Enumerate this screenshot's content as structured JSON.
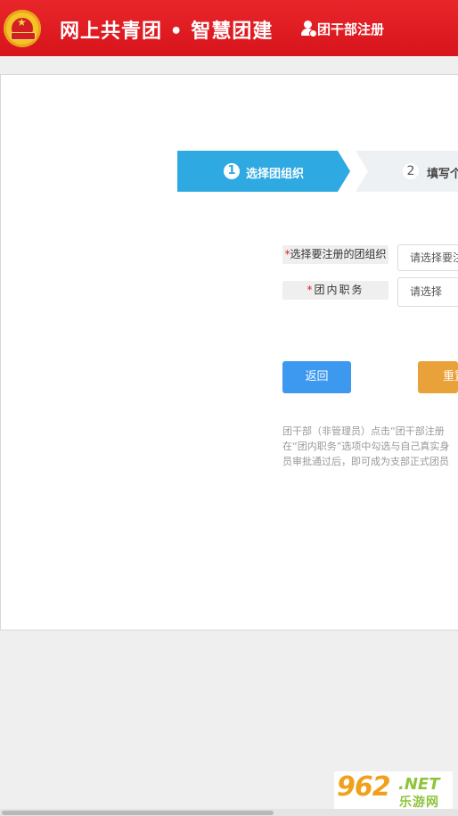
{
  "header": {
    "title": "网上共青团 • 智慧团建",
    "register_link": "团干部注册"
  },
  "steps": [
    {
      "number": "1",
      "label": "选择团组织",
      "active": true
    },
    {
      "number": "2",
      "label": "填写个",
      "active": false
    }
  ],
  "form": {
    "org": {
      "required_mark": "*",
      "label": "选择要注册的团组织",
      "placeholder": "请选择要注"
    },
    "position": {
      "required_mark": "*",
      "label": "团内职务",
      "placeholder": "请选择"
    }
  },
  "buttons": {
    "back": "返回",
    "reset": "重置"
  },
  "note": {
    "lines": [
      "团干部（非管理员）点击“团干部注册",
      "在“团内职务”选项中勾选与自己真实身",
      "员审批通过后，即可成为支部正式团员"
    ]
  },
  "watermark": {
    "number": "962",
    "net": ".NET",
    "cn": "乐游网"
  },
  "colors": {
    "header_red": "#d8141c",
    "step_active": "#2fa9e1",
    "back_button": "#3d98f0",
    "reset_button": "#e9a23a"
  }
}
